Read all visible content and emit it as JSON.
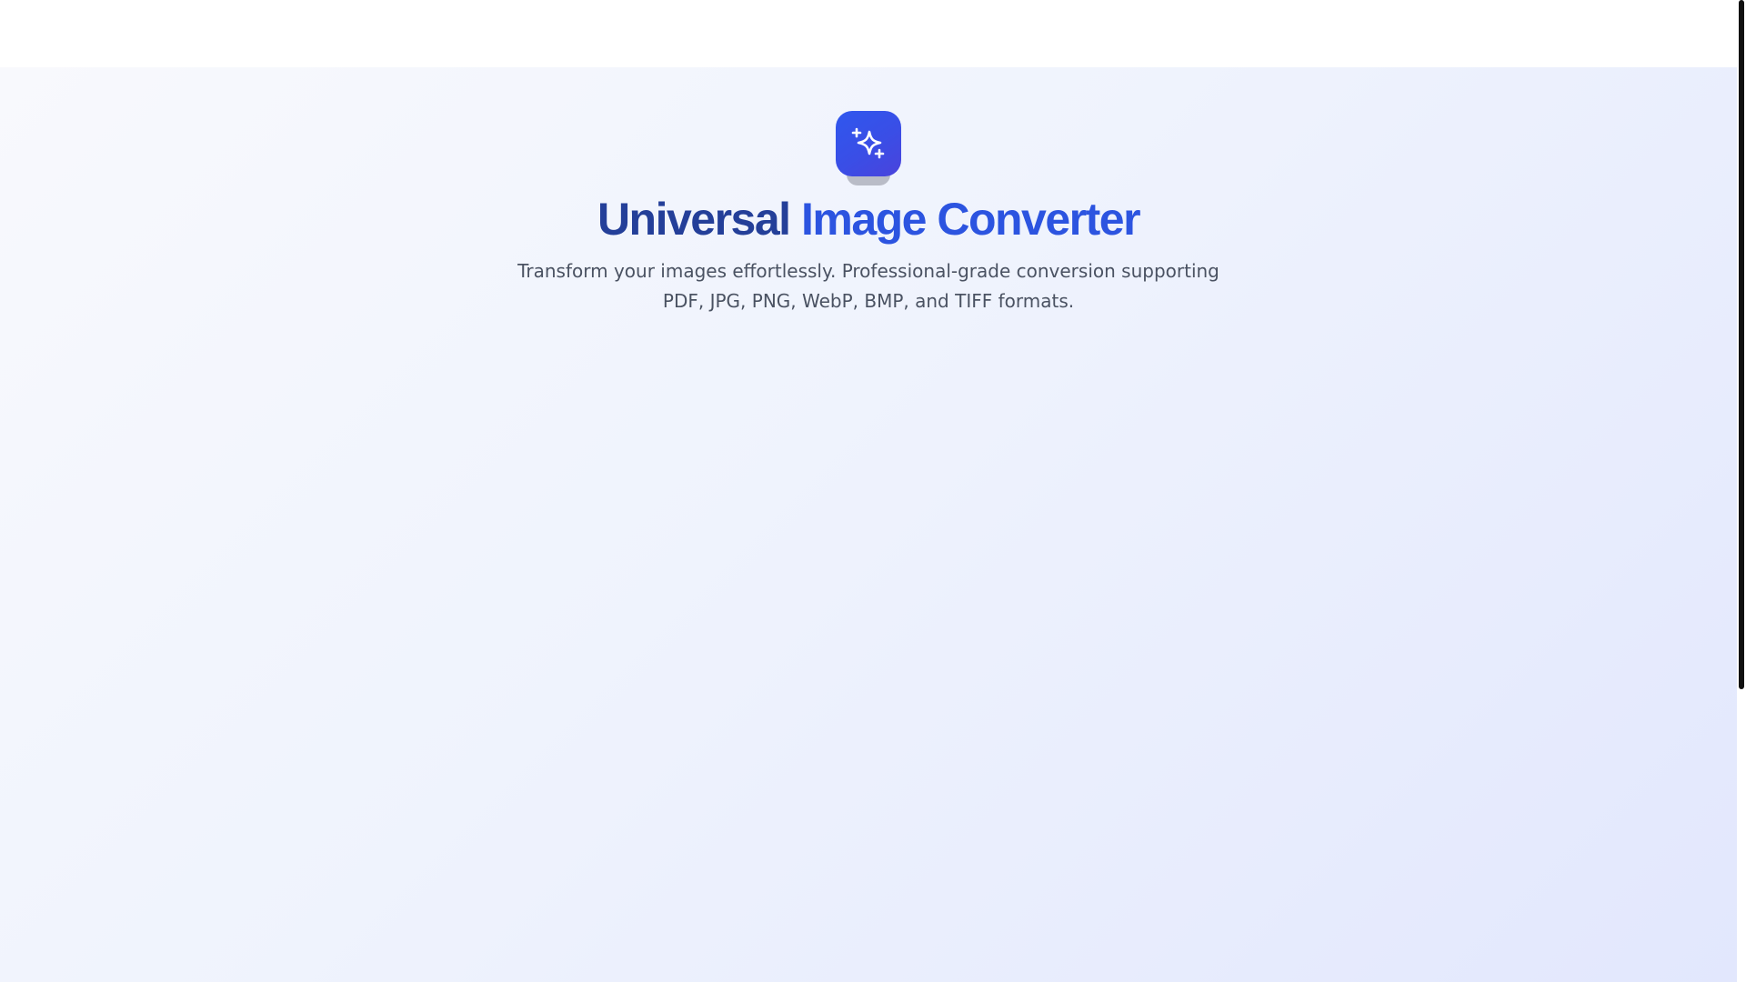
{
  "header": {
    "title_part1": "Universal",
    "title_part2": "Image Converter",
    "subtitle": "Transform your images effortlessly. Professional-grade conversion supporting PDF, JPG, PNG, WebP, BMP, and TIFF formats."
  },
  "logo": {
    "icon": "sparkles-icon"
  },
  "colors": {
    "brand_dark": "#243f99",
    "brand": "#2c54e0",
    "logo_bg": "#3a4ee6",
    "subtitle_text": "#4a5262"
  }
}
